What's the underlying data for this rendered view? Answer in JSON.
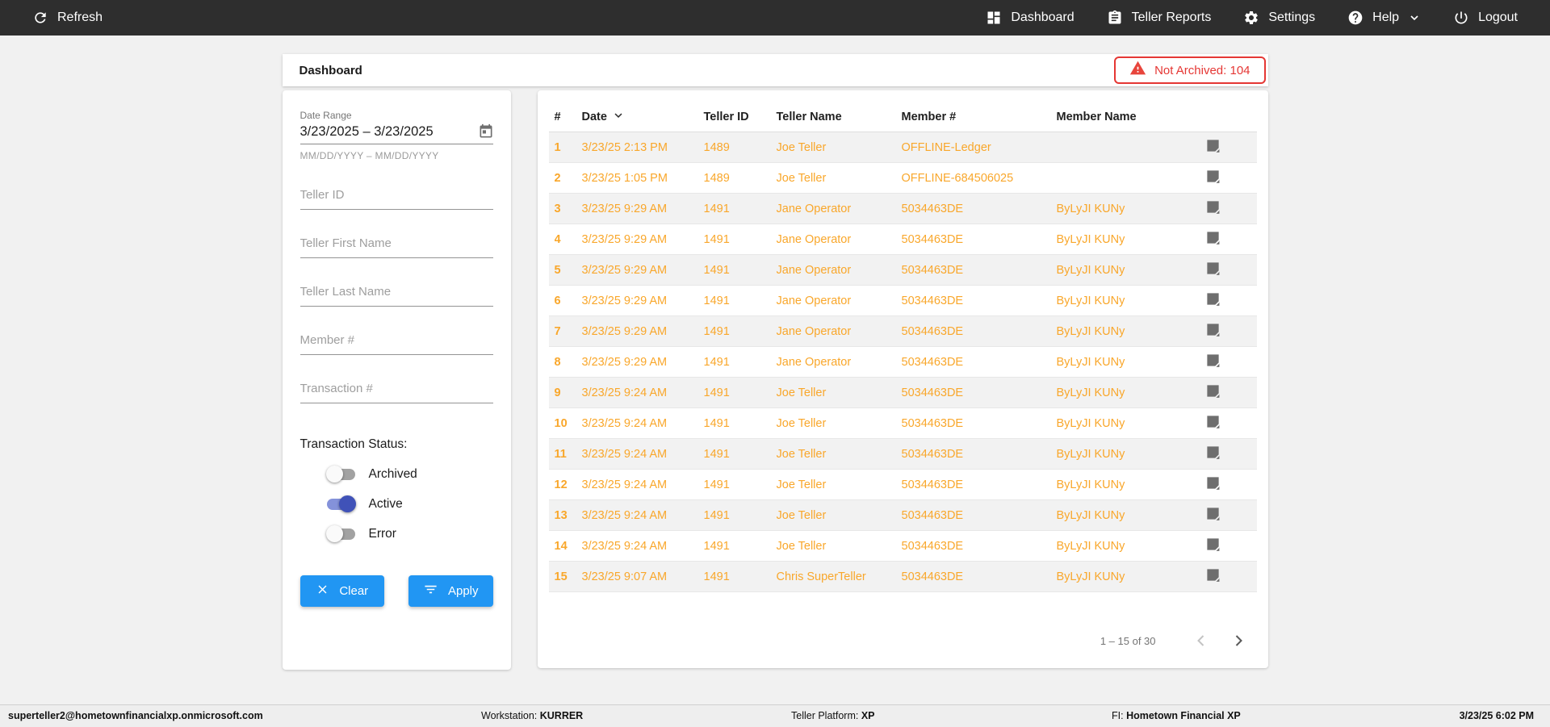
{
  "navbar": {
    "refresh_label": "Refresh",
    "items": [
      {
        "label": "Dashboard"
      },
      {
        "label": "Teller Reports"
      },
      {
        "label": "Settings"
      },
      {
        "label": "Help"
      },
      {
        "label": "Logout"
      }
    ]
  },
  "header": {
    "title": "Dashboard",
    "not_archived_badge": "Not Archived: 104"
  },
  "filters": {
    "date_range": {
      "label": "Date Range",
      "value": "3/23/2025 – 3/23/2025",
      "helper": "MM/DD/YYYY – MM/DD/YYYY"
    },
    "fields": [
      {
        "placeholder": "Teller ID"
      },
      {
        "placeholder": "Teller First Name"
      },
      {
        "placeholder": "Teller Last Name"
      },
      {
        "placeholder": "Member #"
      },
      {
        "placeholder": "Transaction #"
      }
    ],
    "status": {
      "label": "Transaction Status:",
      "toggles": [
        {
          "label": "Archived",
          "on": false
        },
        {
          "label": "Active",
          "on": true
        },
        {
          "label": "Error",
          "on": false
        }
      ]
    },
    "clear_label": "Clear",
    "apply_label": "Apply"
  },
  "table": {
    "columns": [
      "#",
      "Date",
      "Teller ID",
      "Teller Name",
      "Member #",
      "Member Name"
    ],
    "rows": [
      {
        "num": "1",
        "date": "3/23/25 2:13 PM",
        "teller_id": "1489",
        "teller_name": "Joe Teller",
        "member_num": "OFFLINE-Ledger",
        "member_name": ""
      },
      {
        "num": "2",
        "date": "3/23/25 1:05 PM",
        "teller_id": "1489",
        "teller_name": "Joe Teller",
        "member_num": "OFFLINE-684506025",
        "member_name": ""
      },
      {
        "num": "3",
        "date": "3/23/25 9:29 AM",
        "teller_id": "1491",
        "teller_name": "Jane Operator",
        "member_num": "5034463DE",
        "member_name": "ByLyJI KUNy"
      },
      {
        "num": "4",
        "date": "3/23/25 9:29 AM",
        "teller_id": "1491",
        "teller_name": "Jane Operator",
        "member_num": "5034463DE",
        "member_name": "ByLyJI KUNy"
      },
      {
        "num": "5",
        "date": "3/23/25 9:29 AM",
        "teller_id": "1491",
        "teller_name": "Jane Operator",
        "member_num": "5034463DE",
        "member_name": "ByLyJI KUNy"
      },
      {
        "num": "6",
        "date": "3/23/25 9:29 AM",
        "teller_id": "1491",
        "teller_name": "Jane Operator",
        "member_num": "5034463DE",
        "member_name": "ByLyJI KUNy"
      },
      {
        "num": "7",
        "date": "3/23/25 9:29 AM",
        "teller_id": "1491",
        "teller_name": "Jane Operator",
        "member_num": "5034463DE",
        "member_name": "ByLyJI KUNy"
      },
      {
        "num": "8",
        "date": "3/23/25 9:29 AM",
        "teller_id": "1491",
        "teller_name": "Jane Operator",
        "member_num": "5034463DE",
        "member_name": "ByLyJI KUNy"
      },
      {
        "num": "9",
        "date": "3/23/25 9:24 AM",
        "teller_id": "1491",
        "teller_name": "Joe Teller",
        "member_num": "5034463DE",
        "member_name": "ByLyJI KUNy"
      },
      {
        "num": "10",
        "date": "3/23/25 9:24 AM",
        "teller_id": "1491",
        "teller_name": "Joe Teller",
        "member_num": "5034463DE",
        "member_name": "ByLyJI KUNy"
      },
      {
        "num": "11",
        "date": "3/23/25 9:24 AM",
        "teller_id": "1491",
        "teller_name": "Joe Teller",
        "member_num": "5034463DE",
        "member_name": "ByLyJI KUNy"
      },
      {
        "num": "12",
        "date": "3/23/25 9:24 AM",
        "teller_id": "1491",
        "teller_name": "Joe Teller",
        "member_num": "5034463DE",
        "member_name": "ByLyJI KUNy"
      },
      {
        "num": "13",
        "date": "3/23/25 9:24 AM",
        "teller_id": "1491",
        "teller_name": "Joe Teller",
        "member_num": "5034463DE",
        "member_name": "ByLyJI KUNy"
      },
      {
        "num": "14",
        "date": "3/23/25 9:24 AM",
        "teller_id": "1491",
        "teller_name": "Joe Teller",
        "member_num": "5034463DE",
        "member_name": "ByLyJI KUNy"
      },
      {
        "num": "15",
        "date": "3/23/25 9:07 AM",
        "teller_id": "1491",
        "teller_name": "Chris SuperTeller",
        "member_num": "5034463DE",
        "member_name": "ByLyJI KUNy"
      }
    ],
    "pagination": {
      "range_label": "1 – 15 of 30"
    }
  },
  "footer": {
    "user": "superteller2@hometownfinancialxp.onmicrosoft.com",
    "workstation_label": "Workstation:",
    "workstation_value": "KURRER",
    "platform_label": "Teller Platform:",
    "platform_value": "XP",
    "fi_label": "FI:",
    "fi_value": "Hometown Financial XP",
    "datetime": "3/23/25 6:02 PM"
  },
  "colors": {
    "navbar_bg": "#2e2e2e",
    "accent_blue": "#2196f3",
    "row_orange": "#f9a72b",
    "error_red": "#e53734",
    "toggle_on": "#4052b8"
  }
}
